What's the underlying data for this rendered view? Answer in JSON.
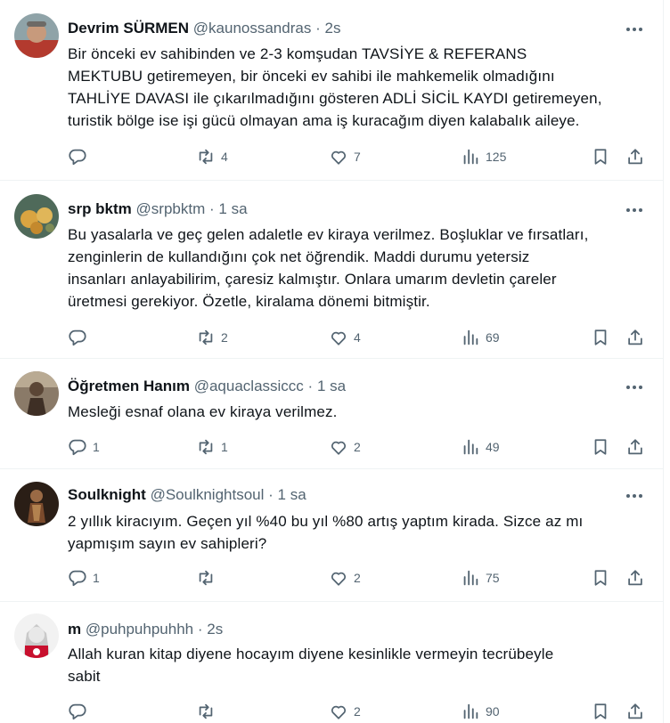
{
  "tweets": [
    {
      "name": "Devrim SÜRMEN",
      "handle": "@kaunossandras",
      "sep": "·",
      "time": "2s",
      "lines": [
        "Bir önceki ev sahibinden ve 2-3 komşudan TAVSİYE & REFERANS",
        "MEKTUBU getiremeyen, bir önceki ev sahibi ile mahkemelik olmadığını",
        "TAHLİYE DAVASI ile çıkarılmadığını gösteren ADLİ SİCİL KAYDI getiremeyen,",
        "turistik bölge ise işi gücü olmayan ama iş kuracağım diyen kalabalık aileye."
      ],
      "replies": "",
      "retweets": "4",
      "likes": "7",
      "views": "125"
    },
    {
      "name": "srp bktm",
      "handle": "@srpbktm",
      "sep": "·",
      "time": "1 sa",
      "lines": [
        "Bu yasalarla ve geç gelen adaletle ev kiraya verilmez. Boşluklar ve fırsatları,",
        "zenginlerin de kullandığını çok net öğrendik. Maddi durumu yetersiz",
        "insanları anlayabilirim, çaresiz kalmıştır. Onlara umarım devletin çareler",
        "üretmesi gerekiyor. Özetle, kiralama dönemi bitmiştir."
      ],
      "replies": "",
      "retweets": "2",
      "likes": "4",
      "views": "69"
    },
    {
      "name": "Öğretmen Hanım",
      "handle": "@aquaclassiccc",
      "sep": "·",
      "time": "1 sa",
      "lines": [
        "Mesleği esnaf olana ev kiraya verilmez."
      ],
      "replies": "1",
      "retweets": "1",
      "likes": "2",
      "views": "49"
    },
    {
      "name": "Soulknight",
      "handle": "@Soulknightsoul",
      "sep": "·",
      "time": "1 sa",
      "lines": [
        "2 yıllık kiracıyım. Geçen yıl %40 bu yıl %80 artış yaptım kirada. Sizce az mı",
        "yapmışım sayın ev sahipleri?"
      ],
      "replies": "1",
      "retweets": "",
      "likes": "2",
      "views": "75"
    },
    {
      "name": "m",
      "handle": "@puhpuhpuhhh",
      "sep": "·",
      "time": "2s",
      "lines": [
        "Allah kuran kitap diyene hocayım diyene kesinlikle vermeyin tecrübeyle",
        "sabit"
      ],
      "replies": "",
      "retweets": "",
      "likes": "2",
      "views": "90"
    }
  ],
  "icons": {
    "more": "more-dots-icon",
    "reply": "reply-icon",
    "retweet": "retweet-icon",
    "like": "heart-icon",
    "views": "views-icon",
    "bookmark": "bookmark-icon",
    "share": "share-icon"
  },
  "colors": {
    "text": "#0f1419",
    "secondary": "#536471",
    "divider": "#eff3f4"
  }
}
